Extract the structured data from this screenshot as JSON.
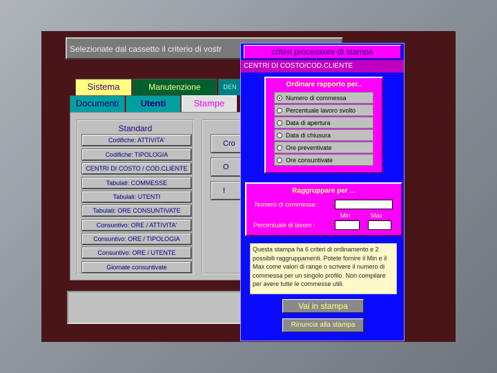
{
  "title_text": "Selezionate dal cassetto il criterio di vostr",
  "tabs_top": [
    {
      "label": "Sistema",
      "bg": "#ffff80"
    },
    {
      "label": "Manutenzione",
      "bg": "#006030"
    },
    {
      "label": "DEN",
      "bg": "#008080"
    }
  ],
  "tabs_bottom": [
    {
      "label": "Documenti",
      "bg": "#00a0a0"
    },
    {
      "label": "Utenti",
      "bg": "#00a0a0"
    },
    {
      "label": "Stampe",
      "bg": "#e0e0e0"
    }
  ],
  "standard": {
    "title": "Standard",
    "buttons": [
      "Codifiche: ATTIVITA'",
      "Codifiche: TIPOLOGIA",
      "CENTRI DI COSTO / COD.CLIENTE",
      "Tabulati: COMMESSE",
      "Tabulati: UTENTI",
      "Tabulati: ORE CONSUNTIVATE",
      "Consuntivo: ORE / ATTIVITA'",
      "Consuntivo: ORE / TIPOLOGIA",
      "Consuntivo: ORE / UTENTE",
      "Giornate consuntivate"
    ]
  },
  "right_buttons": [
    "Cro",
    "O",
    "I"
  ],
  "dialog": {
    "title": "criteri processore di stampa",
    "subtitle": "CENTRI DI COSTO/COD.CLIENTE",
    "order": {
      "title": "Ordinare rapporto per..",
      "options": [
        "Numero di commessa",
        "Percentuale lavoro svolto",
        "Data di apertura",
        "Data di chiusura",
        "Ore preventivate",
        "Ore consuntivate"
      ],
      "selected_index": 0
    },
    "group": {
      "title": "Raggruppare per ...",
      "numero_label": "Numero di commessa :",
      "min_label": "Min",
      "max_label": "Max",
      "percent_label": "Percentuale di lavoro :",
      "numero_value": "",
      "min_value": "",
      "max_value": ""
    },
    "note": "Questa stampa ha 6 criteri di ordinamento e 2 possibili raggruppamenti. Potete fornire il Min e il Max come valori di range o scrivere il numero di commessa per un singolo profilo. Non compilare per avere tutte le commesse utili.",
    "btn_print": "Vai in stampa",
    "btn_cancel": "Rinuncia alla stampa"
  }
}
